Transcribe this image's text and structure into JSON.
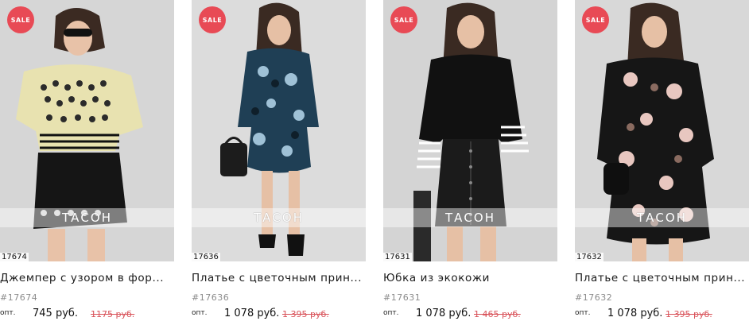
{
  "colors": {
    "sale_badge": "#e84a55",
    "old_price": "#d9535a",
    "sku": "#8c8c8c"
  },
  "products": [
    {
      "sale": "SALE",
      "brand": "ТАСОН",
      "code": "17674",
      "title": "Джемпер с узором в фор...",
      "sku": "#17674",
      "opt": "опт.",
      "price": "745 руб.",
      "old_price": "1175 руб."
    },
    {
      "sale": "SALE",
      "brand": "ТАСОН",
      "code": "17636",
      "title": "Платье с цветочным прин...",
      "sku": "#17636",
      "opt": "опт.",
      "price": "1 078 руб.",
      "old_price": "1 395 руб."
    },
    {
      "sale": "SALE",
      "brand": "ТАСОН",
      "code": "17631",
      "title": "Юбка из экокожи",
      "sku": "#17631",
      "opt": "опт.",
      "price": "1 078 руб.",
      "old_price": "1 465 руб."
    },
    {
      "sale": "SALE",
      "brand": "ТАСОН",
      "code": "17632",
      "title": "Платье с цветочным прин...",
      "sku": "#17632",
      "opt": "опт.",
      "price": "1 078 руб.",
      "old_price": "1 395 руб."
    }
  ]
}
